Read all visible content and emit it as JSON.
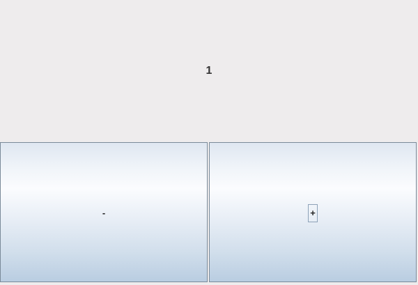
{
  "counter": {
    "value": "1"
  },
  "buttons": {
    "decrement_label": "-",
    "increment_label": "+"
  },
  "colors": {
    "background": "#eeeced",
    "button_border": "#7a8a99",
    "button_gradient_top": "#dfe7f1",
    "button_gradient_bottom": "#b9cde1"
  }
}
